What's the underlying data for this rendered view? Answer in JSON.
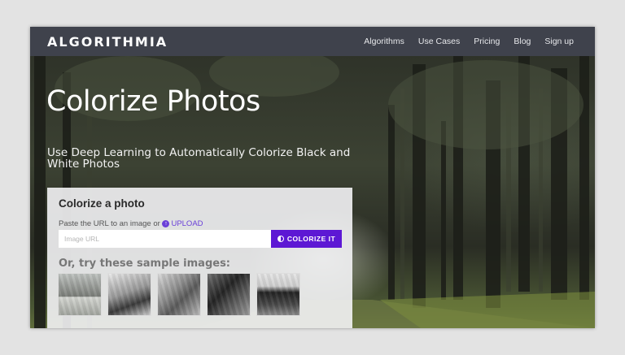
{
  "navbar": {
    "logo": "ALGORITHMIA",
    "links": [
      "Algorithms",
      "Use Cases",
      "Pricing",
      "Blog",
      "Sign up"
    ]
  },
  "hero": {
    "title": "Colorize Photos",
    "subtitle": "Use Deep Learning to Automatically Colorize Black and White Photos"
  },
  "card": {
    "title": "Colorize a photo",
    "url_label": "Paste the URL to an image or",
    "upload_label": "UPLOAD",
    "input_placeholder": "Image URL",
    "input_value": "",
    "button_label": "COLORIZE IT",
    "samples_heading": "Or, try these sample images:",
    "sample_count": 5
  },
  "colors": {
    "navbar": "#3f424c",
    "accent": "#5d18d4",
    "link": "#6a3fd8"
  }
}
